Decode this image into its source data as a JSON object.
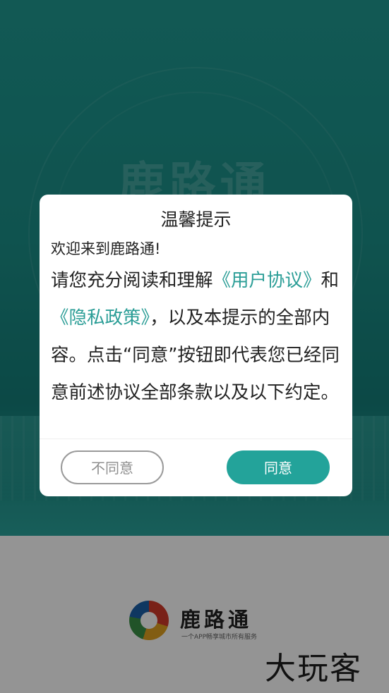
{
  "splash": {
    "watermark_title": "鹿路通",
    "brand_name": "鹿路通",
    "brand_tagline": "一个APP畅享城市所有服务",
    "accent_color": "#23a39a"
  },
  "dialog": {
    "title": "温馨提示",
    "welcome": "欢迎来到鹿路通!",
    "terms": {
      "prefix": "请您充分阅读和理解",
      "user_agreement_link": "《用户协议》",
      "and": "和",
      "privacy_policy_link": "《隐私政策》",
      "suffix": "，以及本提示的全部内容。点击“同意”按钮即代表您已经同意前述协议全部条款以及以下约定。"
    },
    "disagree_label": "不同意",
    "agree_label": "同意"
  },
  "corner_watermark": "大玩客"
}
